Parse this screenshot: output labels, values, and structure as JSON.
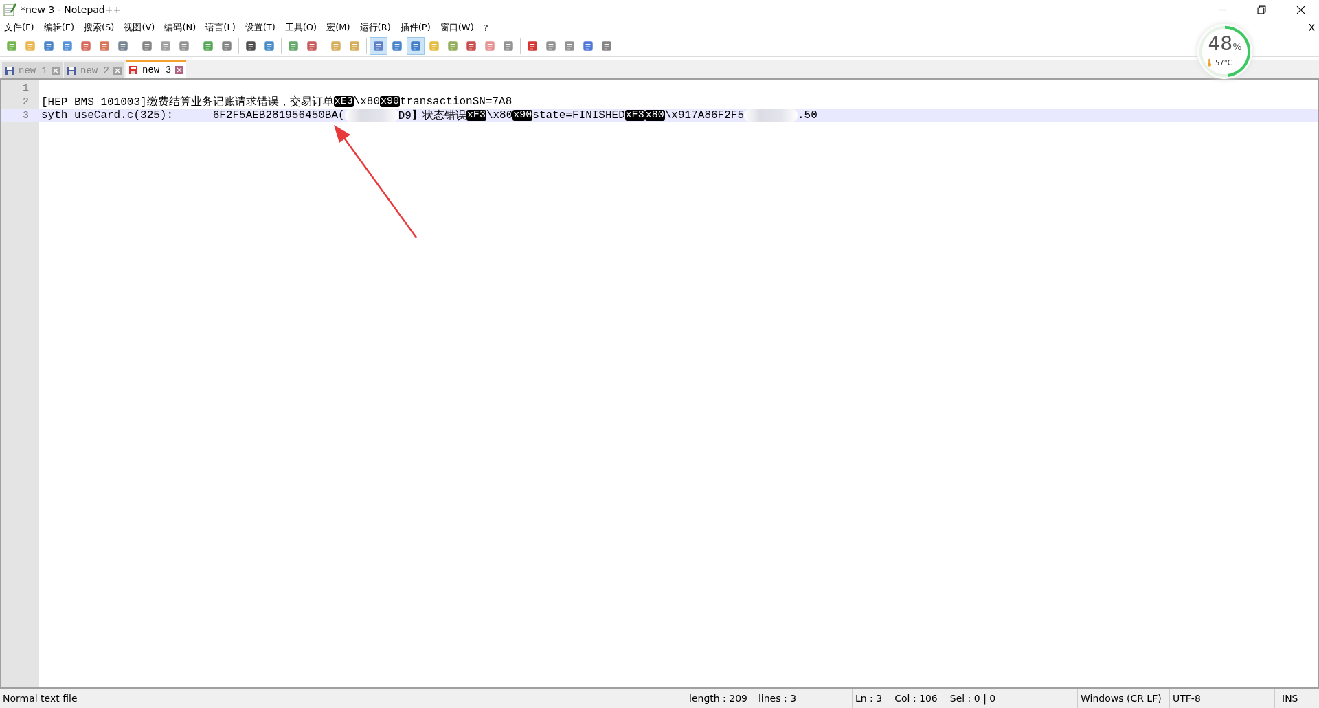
{
  "window": {
    "title": "*new 3 - Notepad++"
  },
  "menu": [
    "文件(F)",
    "编辑(E)",
    "搜索(S)",
    "视图(V)",
    "编码(N)",
    "语言(L)",
    "设置(T)",
    "工具(O)",
    "宏(M)",
    "运行(R)",
    "插件(P)",
    "窗口(W)",
    "?"
  ],
  "menu_close": "X",
  "toolbar": [
    {
      "pressed": false
    },
    {
      "pressed": false
    },
    {
      "pressed": false
    },
    {
      "pressed": false
    },
    {
      "pressed": false
    },
    {
      "pressed": false
    },
    {
      "pressed": false
    },
    {
      "pressed": false
    },
    {
      "pressed": false
    },
    {
      "pressed": false
    },
    {
      "pressed": false
    },
    {
      "pressed": false
    },
    {
      "pressed": false
    },
    {
      "pressed": false
    },
    {
      "pressed": false
    },
    {
      "pressed": false
    },
    {
      "pressed": false
    },
    {
      "pressed": false
    },
    {
      "pressed": true
    },
    {
      "pressed": false
    },
    {
      "pressed": true
    },
    {
      "pressed": false
    },
    {
      "pressed": false
    },
    {
      "pressed": false
    },
    {
      "pressed": false
    },
    {
      "pressed": false
    },
    {
      "pressed": false
    },
    {
      "pressed": false
    },
    {
      "pressed": false
    },
    {
      "pressed": false
    },
    {
      "pressed": false
    }
  ],
  "tabs": [
    {
      "label": "new 1",
      "selected": false,
      "modified": false
    },
    {
      "label": "new 2",
      "selected": false,
      "modified": false
    },
    {
      "label": "new 3",
      "selected": true,
      "modified": true
    }
  ],
  "editor": {
    "lines": [
      {
        "number": "1",
        "current": false
      },
      {
        "number": "2",
        "current": false,
        "segments": [
          {
            "kind": "text",
            "text": "[HEP_BMS_101003]缴费结算业务记账请求错误，交易订单"
          },
          {
            "kind": "control",
            "text": "xE3"
          },
          {
            "kind": "text",
            "text": "\\x80"
          },
          {
            "kind": "control",
            "text": "x90"
          },
          {
            "kind": "text",
            "text": "transactionSN=7A8"
          }
        ]
      },
      {
        "number": "3",
        "current": true,
        "segments": [
          {
            "kind": "text",
            "text": "syth_useCard.c(325):      6F2F5AEB281956450B"
          },
          {
            "kind": "text",
            "text": "A("
          },
          {
            "kind": "blur"
          },
          {
            "kind": "text",
            "text": "D9】状态错误"
          },
          {
            "kind": "control",
            "text": "xE3"
          },
          {
            "kind": "text",
            "text": "\\x80"
          },
          {
            "kind": "control",
            "text": "x90"
          },
          {
            "kind": "text",
            "text": "state=FINISHED"
          },
          {
            "kind": "control",
            "text": "xE3"
          },
          {
            "kind": "control",
            "text": "x80"
          },
          {
            "kind": "text",
            "text": "\\x917A86F2F5"
          },
          {
            "kind": "blur"
          },
          {
            "kind": "text",
            "text": ".50"
          }
        ]
      }
    ]
  },
  "gauge": {
    "value": "48",
    "unit": "%",
    "level": 0.48,
    "temperature": "57°C"
  },
  "status_bar": {
    "file_type": "Normal text file",
    "length": "length : 209",
    "lines": "lines : 3",
    "ln": "Ln : 3",
    "col": "Col : 106",
    "sel": "Sel : 0 | 0",
    "eol": "Windows (CR LF)",
    "encoding": "UTF-8",
    "mode": "INS"
  }
}
